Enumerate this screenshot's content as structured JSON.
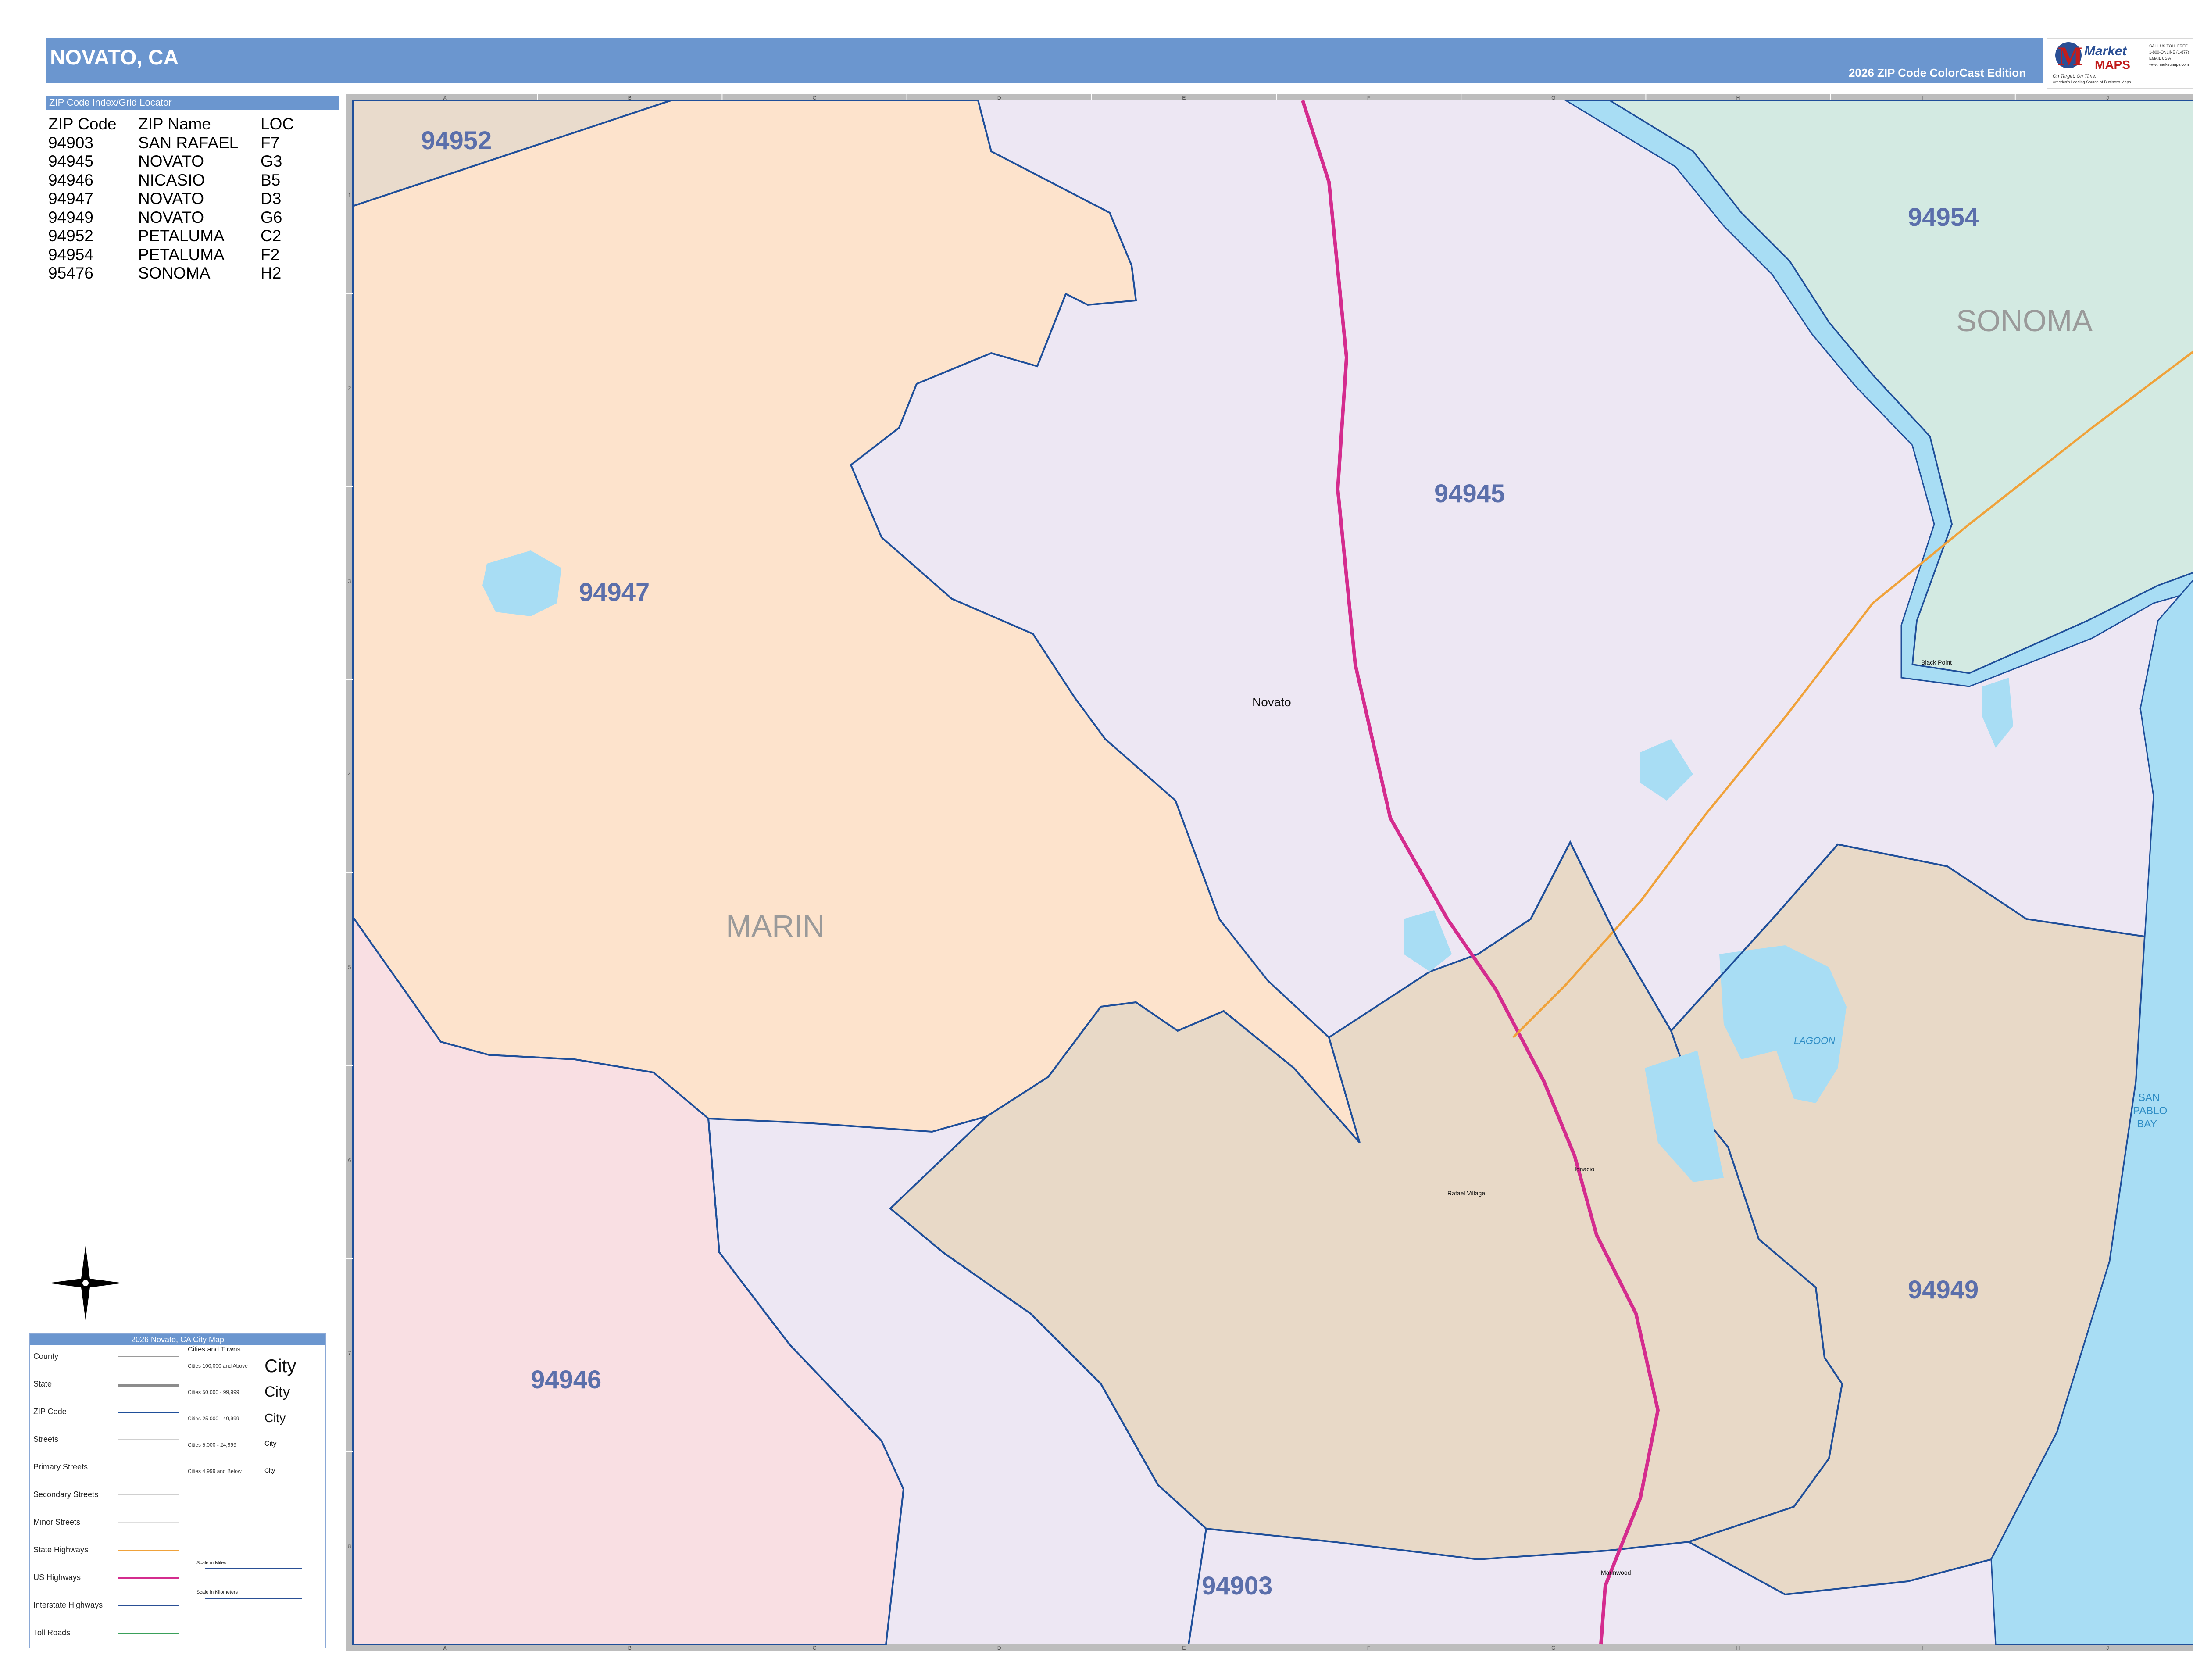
{
  "header": {
    "title": "NOVATO, CA",
    "edition": "2026 ZIP Code ColorCast Edition"
  },
  "logo": {
    "brand_line1": "Market",
    "brand_line2": "MAPS",
    "tagline": "On Target. On Time.",
    "subline": "America's Leading Source of Business Maps",
    "contact": [
      "CALL US TOLL FREE",
      "1-800-ONLINE (1-877)",
      "EMAIL US AT",
      "www.marketmaps.com"
    ]
  },
  "zip_index": {
    "header": "ZIP Code Index/Grid Locator",
    "columns": [
      "ZIP Code",
      "ZIP Name",
      "LOC"
    ],
    "rows": [
      [
        "94903",
        "SAN RAFAEL",
        "F7"
      ],
      [
        "94945",
        "NOVATO",
        "G3"
      ],
      [
        "94946",
        "NICASIO",
        "B5"
      ],
      [
        "94947",
        "NOVATO",
        "D3"
      ],
      [
        "94949",
        "NOVATO",
        "G6"
      ],
      [
        "94952",
        "PETALUMA",
        "C2"
      ],
      [
        "94954",
        "PETALUMA",
        "F2"
      ],
      [
        "95476",
        "SONOMA",
        "H2"
      ]
    ]
  },
  "map": {
    "grid_columns": [
      "A",
      "B",
      "C",
      "D",
      "E",
      "F",
      "G",
      "H",
      "I",
      "J"
    ],
    "grid_rows": [
      "1",
      "2",
      "3",
      "4",
      "5",
      "6",
      "7",
      "8"
    ],
    "zip_labels": [
      {
        "text": "94952",
        "zip": "94952"
      },
      {
        "text": "94954",
        "zip": "94954"
      },
      {
        "text": "94945",
        "zip": "94945"
      },
      {
        "text": "94947",
        "zip": "94947"
      },
      {
        "text": "94949",
        "zip": "94949"
      },
      {
        "text": "94946",
        "zip": "94946"
      },
      {
        "text": "94903",
        "zip": "94903"
      }
    ],
    "county_labels": [
      "SONOMA",
      "MARIN"
    ],
    "place_labels": [
      "Novato",
      "Black Point",
      "Ignacio",
      "Rafael Village",
      "Marinwood"
    ],
    "water_labels": [
      "LAGOON",
      "SAN",
      "PABLO",
      "BAY"
    ],
    "zip_colors": {
      "94952": "#e9dbcc",
      "94954": "#d3eae2",
      "94945": "#ede7f3",
      "94947": "#fde3cc",
      "94949": "#e8d9c7",
      "94946": "#f9dfe3",
      "94903": "#ede7f3"
    },
    "water_color": "#a8ddf4",
    "zip_boundary_color": "#1f4f9a",
    "us_highway_color": "#d42c8e",
    "state_highway_color": "#f0a23a"
  },
  "legend": {
    "title": "2026 Novato, CA City Map",
    "items": [
      "County",
      "State",
      "ZIP Code",
      "Streets",
      "Primary Streets",
      "Secondary Streets",
      "Minor Streets",
      "State Highways",
      "US Highways",
      "Interstate Highways",
      "Toll Roads"
    ],
    "cities_header": "Cities and Towns",
    "city_tiers": [
      "Cities 100,000 and Above",
      "Cities 50,000 - 99,999",
      "Cities 25,000 - 49,999",
      "Cities 5,000 - 24,999",
      "Cities 4,999 and Below"
    ],
    "city_sample": "City",
    "scale_miles": "Scale in Miles",
    "scale_km": "Scale in Kilometers"
  }
}
